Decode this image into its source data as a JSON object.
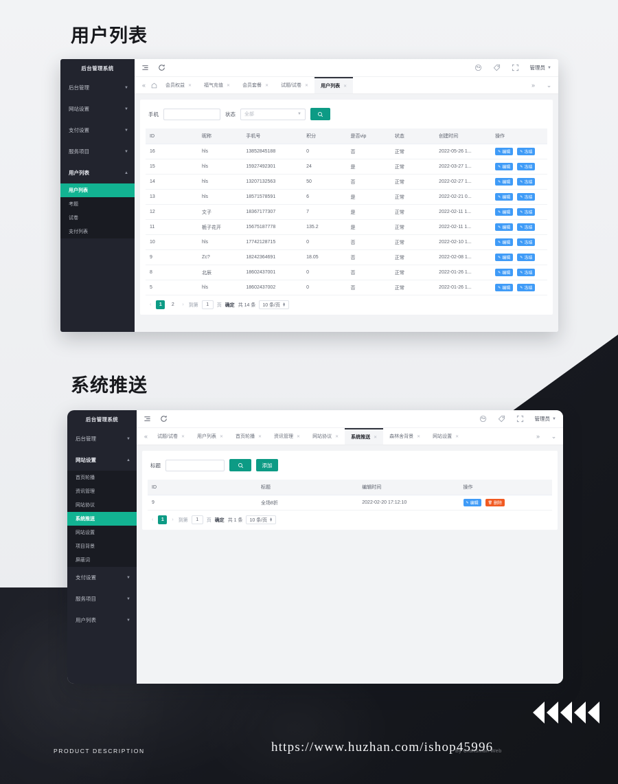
{
  "page": {
    "section1_title": "用户列表",
    "section2_title": "系统推送"
  },
  "accent": {
    "teal": "#0d9b85",
    "active_green": "#12b392",
    "blue": "#3f9bf7",
    "red": "#f15a22",
    "sidebar": "#22242e"
  },
  "panel1": {
    "sidebar": {
      "brand": "后台管理系统",
      "items": [
        {
          "label": "后台管理",
          "caret": "chevron-down-icon",
          "expanded": false
        },
        {
          "label": "网站设置",
          "caret": "chevron-down-icon",
          "expanded": false
        },
        {
          "label": "支付设置",
          "caret": "chevron-down-icon",
          "expanded": false
        },
        {
          "label": "服务项目",
          "caret": "chevron-down-icon",
          "expanded": false
        },
        {
          "label": "用户列表",
          "caret": "chevron-up-icon",
          "expanded": true
        }
      ],
      "subitems": [
        {
          "label": "用户列表",
          "active": true
        },
        {
          "label": "考题",
          "active": false
        },
        {
          "label": "试卷",
          "active": false
        },
        {
          "label": "支付列表",
          "active": false
        }
      ]
    },
    "topbar": {
      "menu_icon": "menu-collapse-icon",
      "refresh_icon": "refresh-icon",
      "theme_icon": "palette-icon",
      "tag_icon": "tag-icon",
      "fullscreen_icon": "fullscreen-icon",
      "user": "管理员"
    },
    "tabbar": {
      "prev_icon": "double-chevron-left-icon",
      "home_icon": "home-icon",
      "next_icon": "double-chevron-right-icon",
      "more_icon": "chevron-down-icon",
      "tabs": [
        {
          "label": "会员权益",
          "active": false
        },
        {
          "label": "福气充值",
          "active": false
        },
        {
          "label": "会员套餐",
          "active": false
        },
        {
          "label": "试题/试卷",
          "active": false
        },
        {
          "label": "用户列表",
          "active": true
        }
      ]
    },
    "search": {
      "phone_label": "手机",
      "phone_value": "",
      "phone_placeholder": "",
      "status_label": "状态",
      "status_value": "全部",
      "search_icon": "search-icon"
    },
    "table": {
      "columns": [
        "ID",
        "昵称",
        "手机号",
        "积分",
        "是否vip",
        "状态",
        "创建时间",
        "操作"
      ],
      "rows": [
        {
          "id": "16",
          "nick": "hls",
          "phone": "13852845188",
          "points": "0",
          "vip": "否",
          "status": "正常",
          "created": "2022-05-26 1..."
        },
        {
          "id": "15",
          "nick": "hls",
          "phone": "15927492301",
          "points": "24",
          "vip": "是",
          "status": "正常",
          "created": "2022-03-27 1..."
        },
        {
          "id": "14",
          "nick": "hls",
          "phone": "13207132563",
          "points": "50",
          "vip": "否",
          "status": "正常",
          "created": "2022-02-27 1..."
        },
        {
          "id": "13",
          "nick": "hls",
          "phone": "18571578591",
          "points": "6",
          "vip": "是",
          "status": "正常",
          "created": "2022-02-21 0..."
        },
        {
          "id": "12",
          "nick": "文子",
          "phone": "18367177307",
          "points": "7",
          "vip": "是",
          "status": "正常",
          "created": "2022-02-11 1..."
        },
        {
          "id": "11",
          "nick": "栀子花开",
          "phone": "15675187778",
          "points": "135.2",
          "vip": "是",
          "status": "正常",
          "created": "2022-02-11 1..."
        },
        {
          "id": "10",
          "nick": "hls",
          "phone": "17742128715",
          "points": "0",
          "vip": "否",
          "status": "正常",
          "created": "2022-02-10 1..."
        },
        {
          "id": "9",
          "nick": "Zc?",
          "phone": "18242364691",
          "points": "18.05",
          "vip": "否",
          "status": "正常",
          "created": "2022-02-08 1..."
        },
        {
          "id": "8",
          "nick": "北辰",
          "phone": "18602437001",
          "points": "0",
          "vip": "否",
          "status": "正常",
          "created": "2022-01-26 1..."
        },
        {
          "id": "5",
          "nick": "hls",
          "phone": "18602437002",
          "points": "0",
          "vip": "否",
          "status": "正常",
          "created": "2022-01-26 1..."
        }
      ],
      "action_edit": "编辑",
      "action_freeze": "冻结"
    },
    "pager": {
      "prev": "‹",
      "pages": [
        "1",
        "2"
      ],
      "active_page": "1",
      "next": "›",
      "goto_label": "到第",
      "goto_value": "1",
      "page_unit": "页",
      "confirm": "确定",
      "total": "共 14 条",
      "page_size": "10 条/页"
    }
  },
  "panel2": {
    "sidebar": {
      "brand": "后台管理系统",
      "items_top": [
        {
          "label": "后台管理",
          "caret": "chevron-down-icon",
          "expanded": false
        },
        {
          "label": "网站设置",
          "caret": "chevron-up-icon",
          "expanded": true
        }
      ],
      "subitems": [
        {
          "label": "首页轮播",
          "active": false
        },
        {
          "label": "资讯管理",
          "active": false
        },
        {
          "label": "网站协议",
          "active": false
        },
        {
          "label": "系统推送",
          "active": true
        },
        {
          "label": "网站设置",
          "active": false
        },
        {
          "label": "项目背景",
          "active": false
        },
        {
          "label": "屏蔽词",
          "active": false
        }
      ],
      "items_bottom": [
        {
          "label": "支付设置",
          "caret": "chevron-down-icon"
        },
        {
          "label": "服务项目",
          "caret": "chevron-down-icon"
        },
        {
          "label": "用户列表",
          "caret": "chevron-down-icon"
        }
      ]
    },
    "topbar": {
      "menu_icon": "menu-collapse-icon",
      "refresh_icon": "refresh-icon",
      "theme_icon": "palette-icon",
      "tag_icon": "tag-icon",
      "fullscreen_icon": "fullscreen-icon",
      "user": "管理员"
    },
    "tabbar": {
      "tabs": [
        {
          "label": "试题/试卷",
          "active": false
        },
        {
          "label": "用户列表",
          "active": false
        },
        {
          "label": "首页轮播",
          "active": false
        },
        {
          "label": "资讯管理",
          "active": false
        },
        {
          "label": "网站协议",
          "active": false
        },
        {
          "label": "系统推送",
          "active": true
        },
        {
          "label": "森林舍背景",
          "active": false
        },
        {
          "label": "网站设置",
          "active": false
        }
      ]
    },
    "search": {
      "title_label": "标题",
      "title_value": "",
      "search_icon": "search-icon",
      "add_label": "添加"
    },
    "table": {
      "columns": [
        "ID",
        "标题",
        "编辑时间",
        "操作"
      ],
      "rows": [
        {
          "id": "9",
          "title": "全场8折",
          "edited": "2022-02-20 17:12:10"
        }
      ],
      "action_edit": "编辑",
      "action_delete": "删除"
    },
    "pager": {
      "prev": "‹",
      "active_page": "1",
      "next": "›",
      "goto_label": "到第",
      "goto_value": "1",
      "page_unit": "页",
      "confirm": "确定",
      "total": "共 1 条",
      "page_size": "10 条/页"
    }
  },
  "footer": {
    "left_label": "PRODUCT DESCRIPTION",
    "url": "https://www.huzhan.com/ishop45996",
    "watermark": "By Craftsman Web"
  }
}
